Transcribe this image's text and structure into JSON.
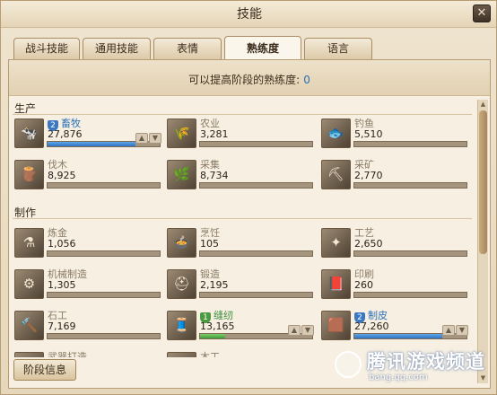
{
  "window": {
    "title": "技能",
    "close_glyph": "✕"
  },
  "tabs": [
    {
      "label": "战斗技能",
      "active": false
    },
    {
      "label": "通用技能",
      "active": false
    },
    {
      "label": "表情",
      "active": false
    },
    {
      "label": "熟练度",
      "active": true
    },
    {
      "label": "语言",
      "active": false
    }
  ],
  "hint": {
    "text": "可以提高阶段的熟练度:",
    "value": "0"
  },
  "sections": {
    "production": "生产",
    "crafting": "制作"
  },
  "skills": [
    {
      "name": "畜牧",
      "value": "27,876",
      "progress": 0.78,
      "icon": "livestock-icon",
      "glyph": "🐄",
      "specialized": true,
      "level": "2",
      "badge_color": "blue",
      "has_arrows": true
    },
    {
      "name": "农业",
      "value": "3,281",
      "progress": 0.0,
      "icon": "farming-icon",
      "glyph": "🌾",
      "specialized": false,
      "has_arrows": false
    },
    {
      "name": "钓鱼",
      "value": "5,510",
      "progress": 0.0,
      "icon": "fishing-icon",
      "glyph": "🐟",
      "specialized": false,
      "has_arrows": false
    },
    {
      "name": "伐木",
      "value": "8,925",
      "progress": 0.0,
      "icon": "logging-icon",
      "glyph": "🪵",
      "specialized": false,
      "has_arrows": false
    },
    {
      "name": "采集",
      "value": "8,734",
      "progress": 0.0,
      "icon": "gathering-icon",
      "glyph": "🌿",
      "specialized": false,
      "has_arrows": false
    },
    {
      "name": "采矿",
      "value": "2,770",
      "progress": 0.0,
      "icon": "mining-icon",
      "glyph": "⛏",
      "specialized": false,
      "has_arrows": false
    },
    {
      "name": "炼金",
      "value": "1,056",
      "progress": 0.0,
      "icon": "alchemy-icon",
      "glyph": "⚗",
      "specialized": false,
      "has_arrows": false
    },
    {
      "name": "烹饪",
      "value": "105",
      "progress": 0.0,
      "icon": "cooking-icon",
      "glyph": "🍲",
      "specialized": false,
      "has_arrows": false
    },
    {
      "name": "工艺",
      "value": "2,650",
      "progress": 0.0,
      "icon": "handicraft-icon",
      "glyph": "✦",
      "specialized": false,
      "has_arrows": false
    },
    {
      "name": "机械制造",
      "value": "1,305",
      "progress": 0.0,
      "icon": "machining-icon",
      "glyph": "⚙",
      "specialized": false,
      "has_arrows": false
    },
    {
      "name": "锻造",
      "value": "2,195",
      "progress": 0.0,
      "icon": "smithing-icon",
      "glyph": "⛑",
      "specialized": false,
      "has_arrows": false
    },
    {
      "name": "印刷",
      "value": "260",
      "progress": 0.0,
      "icon": "printing-icon",
      "glyph": "📕",
      "specialized": false,
      "has_arrows": false
    },
    {
      "name": "石工",
      "value": "7,169",
      "progress": 0.0,
      "icon": "masonry-icon",
      "glyph": "🔨",
      "specialized": false,
      "has_arrows": false
    },
    {
      "name": "缝纫",
      "value": "13,165",
      "progress": 0.22,
      "icon": "tailoring-icon",
      "glyph": "🧵",
      "specialized": true,
      "level": "1",
      "badge_color": "green",
      "has_arrows": true
    },
    {
      "name": "制皮",
      "value": "27,260",
      "progress": 0.78,
      "icon": "leatherwork-icon",
      "glyph": "🟫",
      "specialized": true,
      "level": "2",
      "badge_color": "blue",
      "has_arrows": true
    },
    {
      "name": "武器打造",
      "value": "",
      "progress": 0.0,
      "icon": "weaponsmith-icon",
      "glyph": "⚔",
      "specialized": false,
      "has_arrows": false
    },
    {
      "name": "木工",
      "value": "",
      "progress": 0.0,
      "icon": "carpentry-icon",
      "glyph": "🪚",
      "specialized": false,
      "has_arrows": false
    }
  ],
  "footer": {
    "stage_info_label": "阶段信息"
  },
  "watermark": {
    "text": "腾讯游戏",
    "suffix": "频道",
    "url": "bang.qq.com"
  },
  "colors": {
    "specialized_blue": "#2a6fb6",
    "specialized_green": "#3f8f3f",
    "hint_value": "#2a6fb6"
  }
}
